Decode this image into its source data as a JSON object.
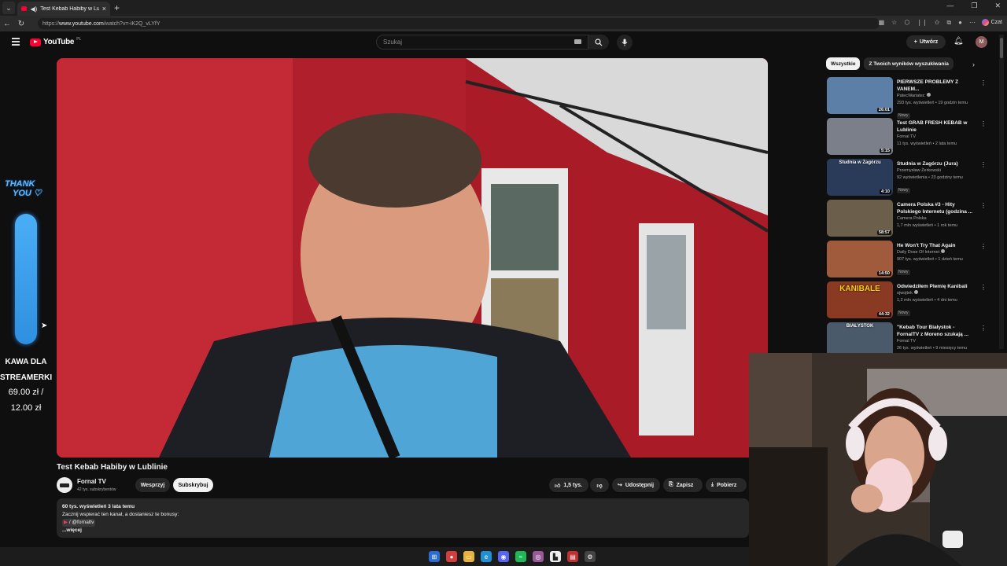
{
  "browser": {
    "tab_title": "Test Kebab Habiby w Lublinie",
    "url_prefix": "https://",
    "url_host": "www.youtube.com",
    "url_path": "/watch?v=-iK2Q_vLYfY",
    "copilot_label": "Czat"
  },
  "header": {
    "logo_text": "YouTube",
    "country_code": "PL",
    "search_placeholder": "Szukaj",
    "create_label": "Utwórz",
    "avatar_letter": "M"
  },
  "overlay": {
    "thank_line1": "THANK",
    "thank_line2": "YOU",
    "goal_line1": "KAWA DLA",
    "goal_line2": "STREAMERKI",
    "goal_line3": "69.00 zł /",
    "goal_line4": "12.00 zł"
  },
  "video": {
    "title": "Test Kebab Habiby w Lublinie",
    "channel": "Fornal TV",
    "subscribers": "42 tys. subskrybentów",
    "support_label": "Wesprzyj",
    "subscribe_label": "Subskrybuj",
    "likes": "1,5 tys.",
    "share_label": "Udostępnij",
    "save_label": "Zapisz",
    "download_label": "Pobierz",
    "description_stats": "60 tys. wyświetleń  3 lata temu",
    "description_line": "Zacznij wspierać ten kanał, a dostaniesz te bonusy:",
    "description_link": "/ @fornaltv",
    "description_more": "...więcej"
  },
  "sidebar": {
    "chips": [
      "Wszystkie",
      "Z Twoich wyników wyszukiwania"
    ],
    "recommendations": [
      {
        "title": "PIERWSZE PROBLEMY Z VANEM...",
        "channel": "PatecWariatec",
        "verified": true,
        "meta": "293 tys. wyświetleń • 19 godzin temu",
        "badge": "Nowy",
        "duration": "26:01",
        "thumb_color": "#5b7fa6"
      },
      {
        "title": "Test GRAB FRESH KEBAB w Lublinie",
        "channel": "Fornal TV",
        "verified": false,
        "meta": "11 tys. wyświetleń • 2 lata temu",
        "badge": "",
        "duration": "5:15",
        "thumb_color": "#7a7f8a"
      },
      {
        "title": "Studnia w Zagórzu (Jura)",
        "channel": "Przemysław Żerkowski",
        "verified": false,
        "meta": "92 wyświetlenia • 23 godziny temu",
        "badge": "Nowy",
        "duration": "4:10",
        "thumb_color": "#2a3b5a",
        "thumb_text": "Studnia w Zagórzu"
      },
      {
        "title": "Camera Polska #3 - Hity Polskiego Internetu (godzina ...",
        "channel": "Camera Polska",
        "verified": false,
        "meta": "1,7 mln wyświetleń • 1 rok temu",
        "badge": "",
        "duration": "58:57",
        "thumb_color": "#6b5e4a"
      },
      {
        "title": "He Won't Try That Again",
        "channel": "Daily Dose Of Internet",
        "verified": true,
        "meta": "907 tys. wyświetleń • 1 dzień temu",
        "badge": "Nowy",
        "duration": "14:50",
        "thumb_color": "#a05a3c"
      },
      {
        "title": "Odwiedziłem Plemię Kanibali",
        "channel": "ojwojtek",
        "verified": true,
        "meta": "1,2 mln wyświetleń • 4 dni temu",
        "badge": "Nowy",
        "duration": "44:32",
        "thumb_color": "#8a3a22",
        "thumb_text": "KANIBALE"
      },
      {
        "title": "\"Kebab Tour Białystok - FornalTV z Moreno szukają ...",
        "channel": "Fornal TV",
        "verified": false,
        "meta": "26 tys. wyświetleń • 9 miesięcy temu",
        "badge": "",
        "duration": "",
        "thumb_color": "#4a5a6a",
        "thumb_text": "BIAŁYSTOK"
      }
    ]
  },
  "colors": {
    "accent_red": "#ff0033",
    "background": "#0f0f0f",
    "overlay_blue": "#4aaef5"
  }
}
